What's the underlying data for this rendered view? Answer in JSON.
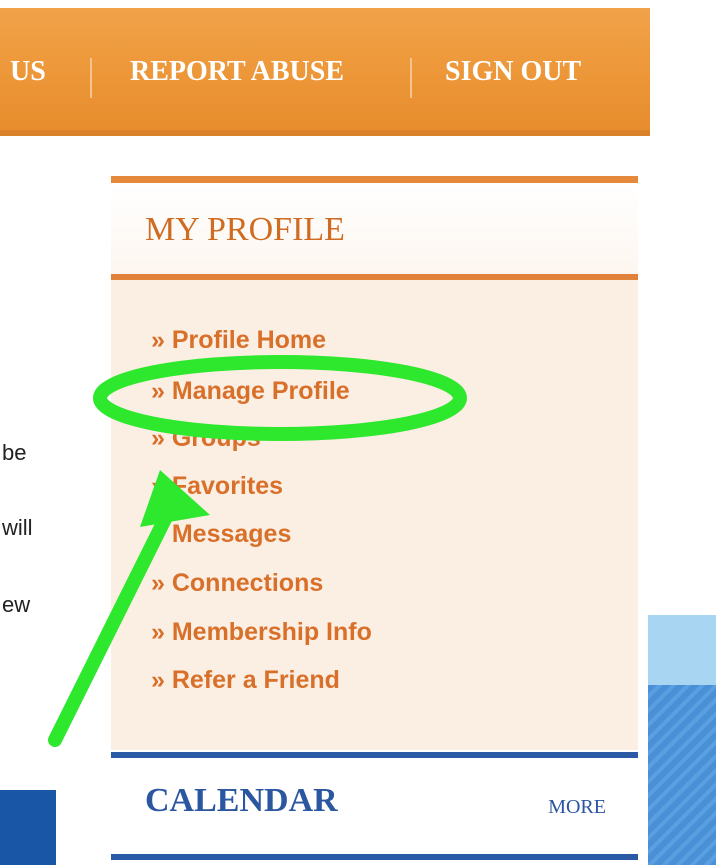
{
  "topnav": {
    "items": [
      "US",
      "REPORT ABUSE",
      "SIGN OUT"
    ]
  },
  "left_fragments": [
    "be",
    "will",
    "ew"
  ],
  "profile": {
    "title": "MY PROFILE",
    "items": [
      "» Profile Home",
      "» Manage Profile",
      "» Groups",
      "» Favorites",
      "» Messages",
      "» Connections",
      "» Membership Info",
      "» Refer a Friend"
    ]
  },
  "calendar": {
    "title": "CALENDAR",
    "more": "MORE"
  },
  "colors": {
    "nav_orange": "#ee9a3c",
    "link_orange": "#d8702a",
    "calendar_blue": "#2b56a0",
    "highlight_green": "#2ee82e"
  }
}
